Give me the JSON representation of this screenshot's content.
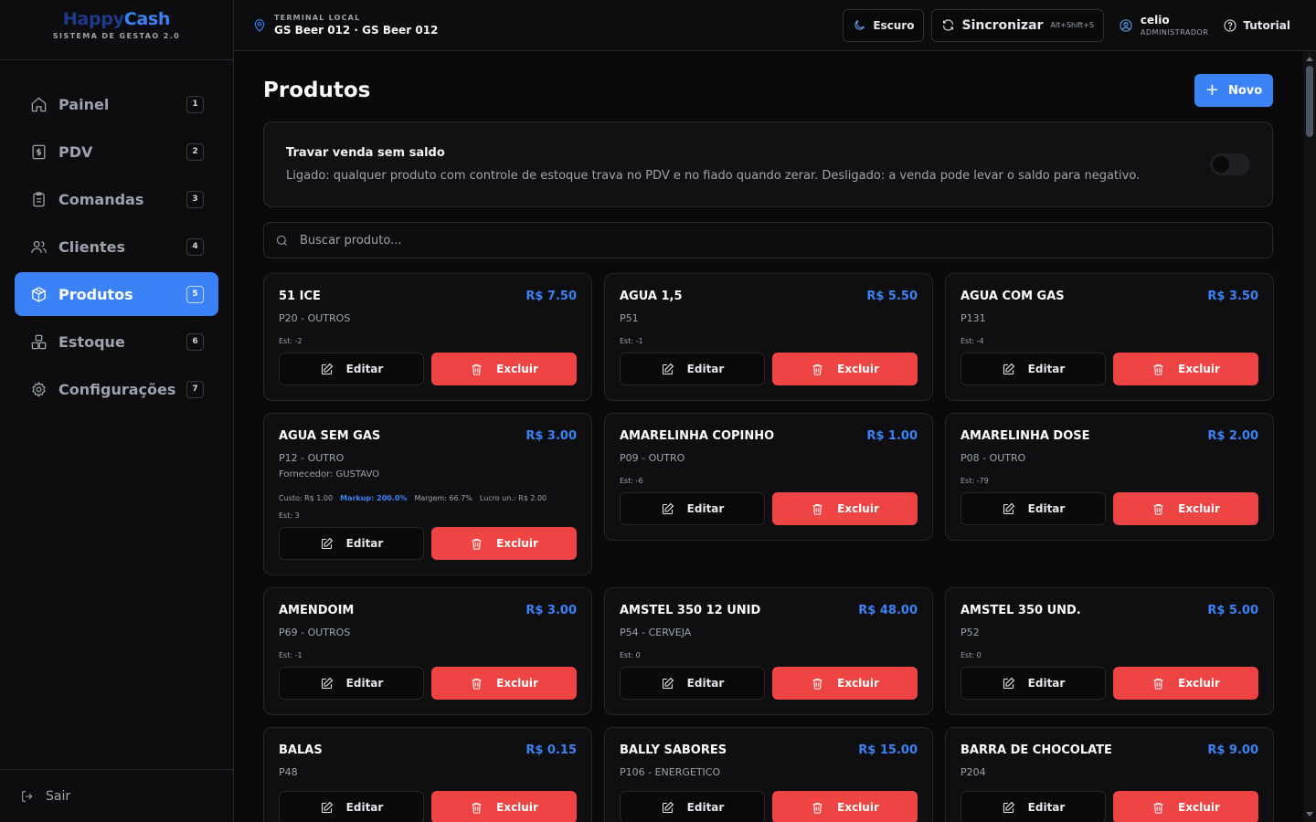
{
  "brand": {
    "logo_part1": "Happy",
    "logo_part2": "Cash",
    "subtitle": "SISTEMA DE GESTAO 2.0"
  },
  "sidebar": {
    "items": [
      {
        "label": "Painel",
        "key": "1",
        "icon": "home-icon",
        "active": false
      },
      {
        "label": "PDV",
        "key": "2",
        "icon": "receipt-icon",
        "active": false
      },
      {
        "label": "Comandas",
        "key": "3",
        "icon": "clipboard-icon",
        "active": false
      },
      {
        "label": "Clientes",
        "key": "4",
        "icon": "users-icon",
        "active": false
      },
      {
        "label": "Produtos",
        "key": "5",
        "icon": "package-icon",
        "active": true
      },
      {
        "label": "Estoque",
        "key": "6",
        "icon": "boxes-icon",
        "active": false
      },
      {
        "label": "Configurações",
        "key": "7",
        "icon": "gear-icon",
        "active": false
      }
    ],
    "logout_label": "Sair"
  },
  "header": {
    "terminal_label": "TERMINAL LOCAL",
    "terminal_name": "GS Beer 012 · GS Beer 012",
    "theme_label": "Escuro",
    "sync_label": "Sincronizar",
    "sync_hint": "Alt+Shift+S",
    "user_name": "celio",
    "user_role": "ADMINISTRADOR",
    "tutorial_label": "Tutorial"
  },
  "page": {
    "title": "Produtos",
    "new_button": "Novo",
    "lock_title": "Travar venda sem saldo",
    "lock_desc": "Ligado: qualquer produto com controle de estoque trava no PDV e no fiado quando zerar. Desligado: a venda pode levar o saldo para negativo.",
    "lock_enabled": false,
    "search_placeholder": "Buscar produto..."
  },
  "labels": {
    "edit": "Editar",
    "delete": "Excluir"
  },
  "products": [
    {
      "name": "51 ICE",
      "price": "R$ 7.50",
      "code": "P20 - OUTROS",
      "stock": "Est: -2"
    },
    {
      "name": "AGUA 1,5",
      "price": "R$ 5.50",
      "code": "P51",
      "stock": "Est: -1"
    },
    {
      "name": "AGUA COM GAS",
      "price": "R$ 3.50",
      "code": "P131",
      "stock": "Est: -4"
    },
    {
      "name": "AGUA SEM GAS",
      "price": "R$ 3.00",
      "code": "P12 - OUTRO",
      "supplier": "Fornecedor: GUSTAVO",
      "cost": "Custo: R$ 1.00",
      "markup": "Markup: 200.0%",
      "margin": "Margem: 66.7%",
      "profit": "Lucro un.: R$ 2.00",
      "stock": "Est: 3"
    },
    {
      "name": "AMARELINHA COPINHO",
      "price": "R$ 1.00",
      "code": "P09 - OUTRO",
      "stock": "Est: -6"
    },
    {
      "name": "AMARELINHA DOSE",
      "price": "R$ 2.00",
      "code": "P08 - OUTRO",
      "stock": "Est: -79"
    },
    {
      "name": "AMENDOIM",
      "price": "R$ 3.00",
      "code": "P69 - OUTROS",
      "stock": "Est: -1"
    },
    {
      "name": "AMSTEL 350 12 UNID",
      "price": "R$ 48.00",
      "code": "P54 - CERVEJA",
      "stock": "Est: 0"
    },
    {
      "name": "AMSTEL 350 UND.",
      "price": "R$ 5.00",
      "code": "P52",
      "stock": "Est: 0"
    },
    {
      "name": "BALAS",
      "price": "R$ 0.15",
      "code": "P48",
      "stock": ""
    },
    {
      "name": "BALLY SABORES",
      "price": "R$ 15.00",
      "code": "P106 - ENERGETICO",
      "stock": ""
    },
    {
      "name": "BARRA DE CHOCOLATE",
      "price": "R$ 9.00",
      "code": "P204",
      "stock": ""
    }
  ],
  "colors": {
    "accent": "#3b82f6",
    "danger": "#ef4444",
    "background": "#0a0a0b"
  }
}
